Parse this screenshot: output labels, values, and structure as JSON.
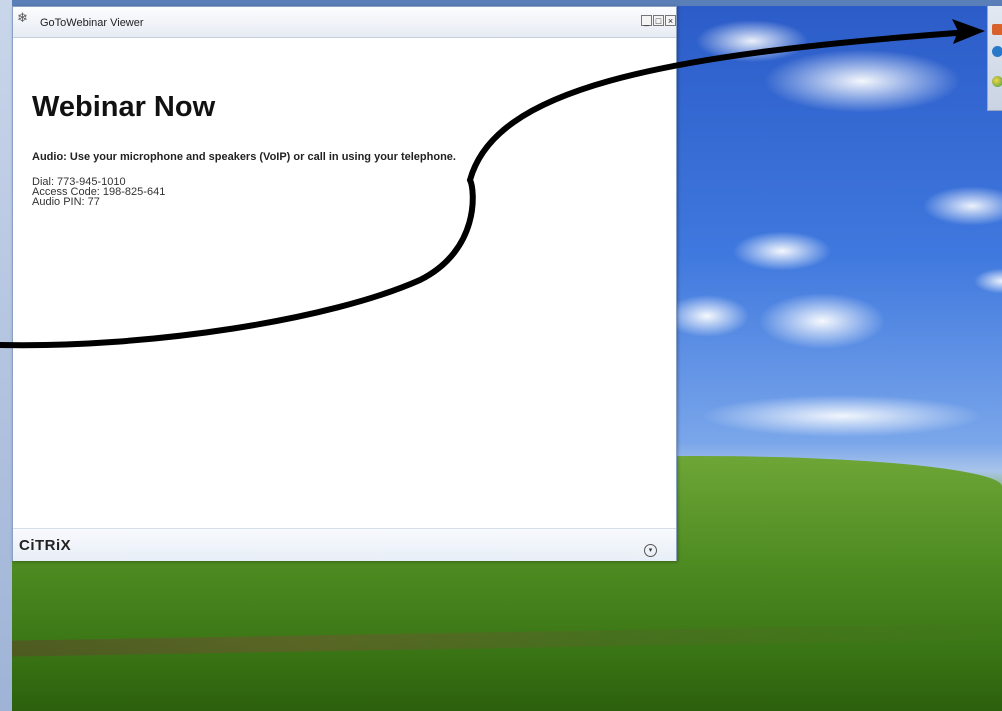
{
  "window": {
    "title": "GoToWebinar Viewer",
    "heading": "Webinar Now",
    "audio_instructions": "Audio: Use your microphone and speakers (VoIP) or call in using your telephone.",
    "dial_in": [
      "Dial: 773-945-1010",
      "Access Code: 198-825-641",
      "Audio PIN: 77"
    ],
    "controls": {
      "minimize": "_",
      "maximize": "□",
      "close": "×"
    },
    "footer": {
      "logo": "CiTRiX",
      "expand_icon": "chevron-down-circle-icon",
      "expand_glyph": "▾"
    }
  },
  "app_icon": "snowflake-icon",
  "app_icon_glyph": "❄",
  "tray": {
    "icons": [
      "orange-panel-icon",
      "blue-circle-icon",
      "globe-icon"
    ]
  },
  "annotation": {
    "type": "hand-drawn arrow",
    "color": "#000000"
  }
}
